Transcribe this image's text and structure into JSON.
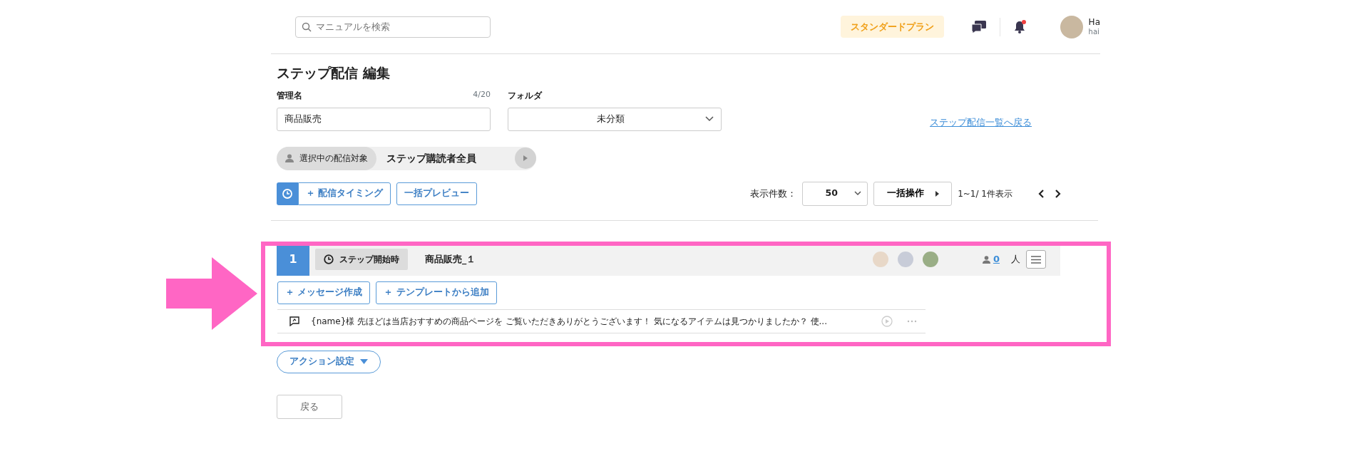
{
  "search": {
    "placeholder": "マニュアルを検索"
  },
  "header": {
    "plan_badge": "スタンダードプラン",
    "unread_notifications": true,
    "user": {
      "name": "Ha",
      "sub": "hai"
    }
  },
  "page_title": "ステップ配信 編集",
  "form": {
    "name_label": "管理名",
    "name_counter": "4/20",
    "name_value": "商品販売",
    "folder_label": "フォルダ",
    "folder_value": "未分類",
    "back_link": "ステップ配信一覧へ戻る"
  },
  "target": {
    "label": "選択中の配信対象",
    "value": "ステップ購読者全員"
  },
  "toolbar": {
    "timing_button": "＋ 配信タイミング",
    "preview_button": "一括プレビュー",
    "per_page_label": "表示件数：",
    "per_page_value": "50",
    "bulk_button": "一括操作",
    "range": "1~1/ 1件表示"
  },
  "steps": [
    {
      "number": "1",
      "trigger": "ステップ開始時",
      "name": "商品販売_１",
      "count": "0",
      "count_unit": "人",
      "buttons": [
        "＋ メッセージ作成",
        "＋ テンプレートから追加"
      ],
      "messages": [
        {
          "text": "{name}様 先ほどは当店おすすめの商品ページを ご覧いただきありがとうございます！ 気になるアイテムは見つかりましたか？ 使..."
        }
      ]
    }
  ],
  "action_button": "アクション設定",
  "back_button": "戻る"
}
